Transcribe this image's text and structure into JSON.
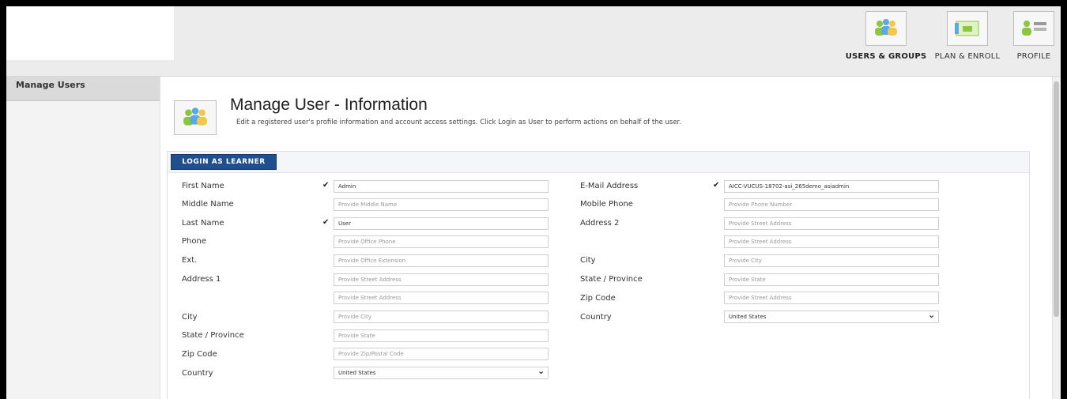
{
  "nav": {
    "items": [
      {
        "label": "USERS & GROUPS",
        "icon": "users-icon",
        "active": true
      },
      {
        "label": "PLAN & ENROLL",
        "icon": "plan-icon",
        "active": false
      },
      {
        "label": "PROFILE",
        "icon": "profile-icon",
        "active": false
      }
    ]
  },
  "sidebar": {
    "items": [
      {
        "label": "Manage Users"
      }
    ]
  },
  "page": {
    "title": "Manage User - Information",
    "description": "Edit a registered user's profile information and account access settings. Click Login as User to perform actions on behalf of the user."
  },
  "actions": {
    "login_label": "LOGIN AS LEARNER"
  },
  "form": {
    "left": {
      "first_name": {
        "label": "First Name",
        "value": "Admin",
        "check": "✔"
      },
      "middle_name": {
        "label": "Middle Name",
        "placeholder": "Provide Middle Name"
      },
      "last_name": {
        "label": "Last Name",
        "value": "User",
        "check": "✔"
      },
      "phone": {
        "label": "Phone",
        "placeholder": "Provide Office Phone"
      },
      "ext": {
        "label": "Ext.",
        "placeholder": "Provide Office Extension"
      },
      "address1": {
        "label": "Address 1",
        "placeholder": "Provide Street Address"
      },
      "address1b": {
        "placeholder": "Provide Street Address"
      },
      "city": {
        "label": "City",
        "placeholder": "Provide City"
      },
      "state": {
        "label": "State / Province",
        "placeholder": "Provide State"
      },
      "zip": {
        "label": "Zip Code",
        "placeholder": "Provide Zip/Postal Code"
      },
      "country": {
        "label": "Country",
        "value": "United States"
      }
    },
    "right": {
      "email": {
        "label": "E-Mail Address",
        "value": "AICC-VUCUS-18702-asi_265demo_asiadmin",
        "check": "✔"
      },
      "mobile": {
        "label": "Mobile Phone",
        "placeholder": "Provide Phone Number"
      },
      "address2": {
        "label": "Address 2",
        "placeholder": "Provide Street Address"
      },
      "address2b": {
        "placeholder": "Provide Street Address"
      },
      "city": {
        "label": "City",
        "placeholder": "Provide City"
      },
      "state": {
        "label": "State / Province",
        "placeholder": "Provide State"
      },
      "zip": {
        "label": "Zip Code",
        "placeholder": "Provide Street Address"
      },
      "country": {
        "label": "Country",
        "value": "United States"
      }
    }
  }
}
